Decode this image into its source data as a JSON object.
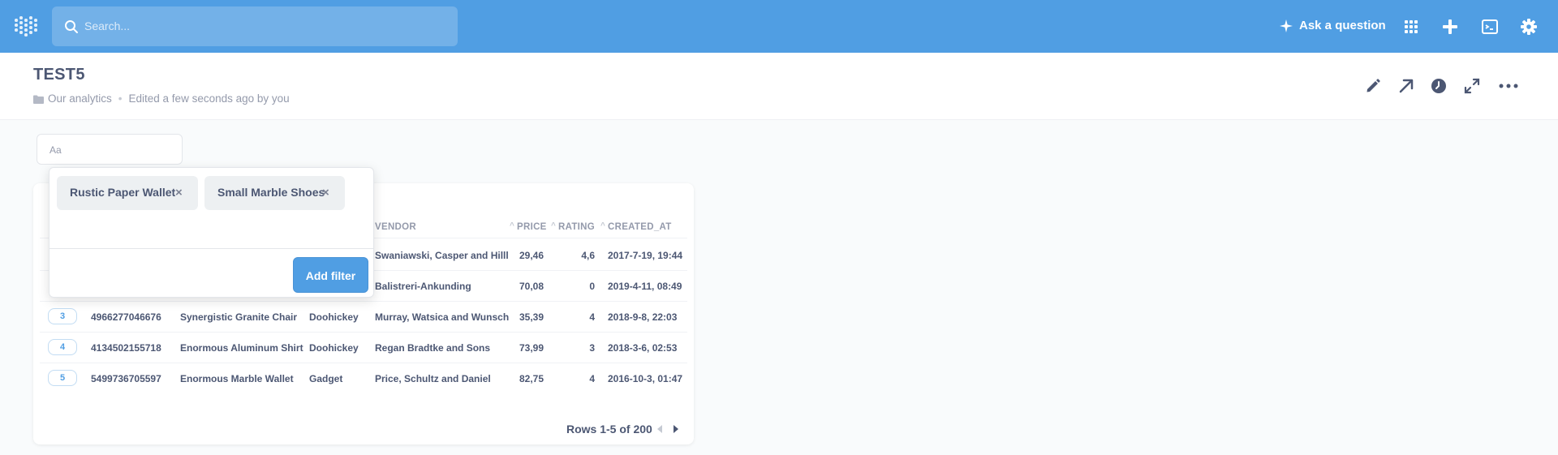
{
  "topnav": {
    "search_placeholder": "Search...",
    "ask_label": "Ask a question",
    "icons": [
      "logo-icon",
      "search-icon",
      "sparkle-icon",
      "grid-icon",
      "plus-icon",
      "terminal-icon",
      "gear-icon"
    ]
  },
  "header": {
    "title": "TEST5",
    "collection": "Our analytics",
    "edited": "Edited a few seconds ago by you",
    "actions": [
      "pencil-icon",
      "share-arrow-icon",
      "clock-icon",
      "expand-icon",
      "more-icon"
    ]
  },
  "filter_widget": {
    "placeholder": "Aa"
  },
  "popover": {
    "tags": [
      "Rustic Paper Wallet",
      "Small Marble Shoes"
    ],
    "add_filter_label": "Add filter"
  },
  "table": {
    "columns": [
      "VENDOR",
      "PRICE",
      "RATING",
      "CREATED_AT"
    ],
    "rows": [
      {
        "id": "",
        "ean": "",
        "title": "",
        "category": "",
        "vendor": "Swaniawski, Casper and Hilll",
        "price": "29,46",
        "rating": "4,6",
        "created_at": "2017-7-19, 19:44"
      },
      {
        "id": "",
        "ean": "",
        "title": "",
        "category": "",
        "vendor": "Balistreri-Ankunding",
        "price": "70,08",
        "rating": "0",
        "created_at": "2019-4-11, 08:49"
      },
      {
        "id": "3",
        "ean": "4966277046676",
        "title": "Synergistic Granite Chair",
        "category": "Doohickey",
        "vendor": "Murray, Watsica and Wunsch",
        "price": "35,39",
        "rating": "4",
        "created_at": "2018-9-8, 22:03"
      },
      {
        "id": "4",
        "ean": "4134502155718",
        "title": "Enormous Aluminum Shirt",
        "category": "Doohickey",
        "vendor": "Regan Bradtke and Sons",
        "price": "73,99",
        "rating": "3",
        "created_at": "2018-3-6, 02:53"
      },
      {
        "id": "5",
        "ean": "5499736705597",
        "title": "Enormous Marble Wallet",
        "category": "Gadget",
        "vendor": "Price, Schultz and Daniel",
        "price": "82,75",
        "rating": "4",
        "created_at": "2016-10-3, 01:47"
      }
    ],
    "pagination": "Rows 1-5 of 200"
  },
  "colors": {
    "brand": "#509ee3",
    "text": "#4c5773",
    "muted": "#949aab"
  }
}
